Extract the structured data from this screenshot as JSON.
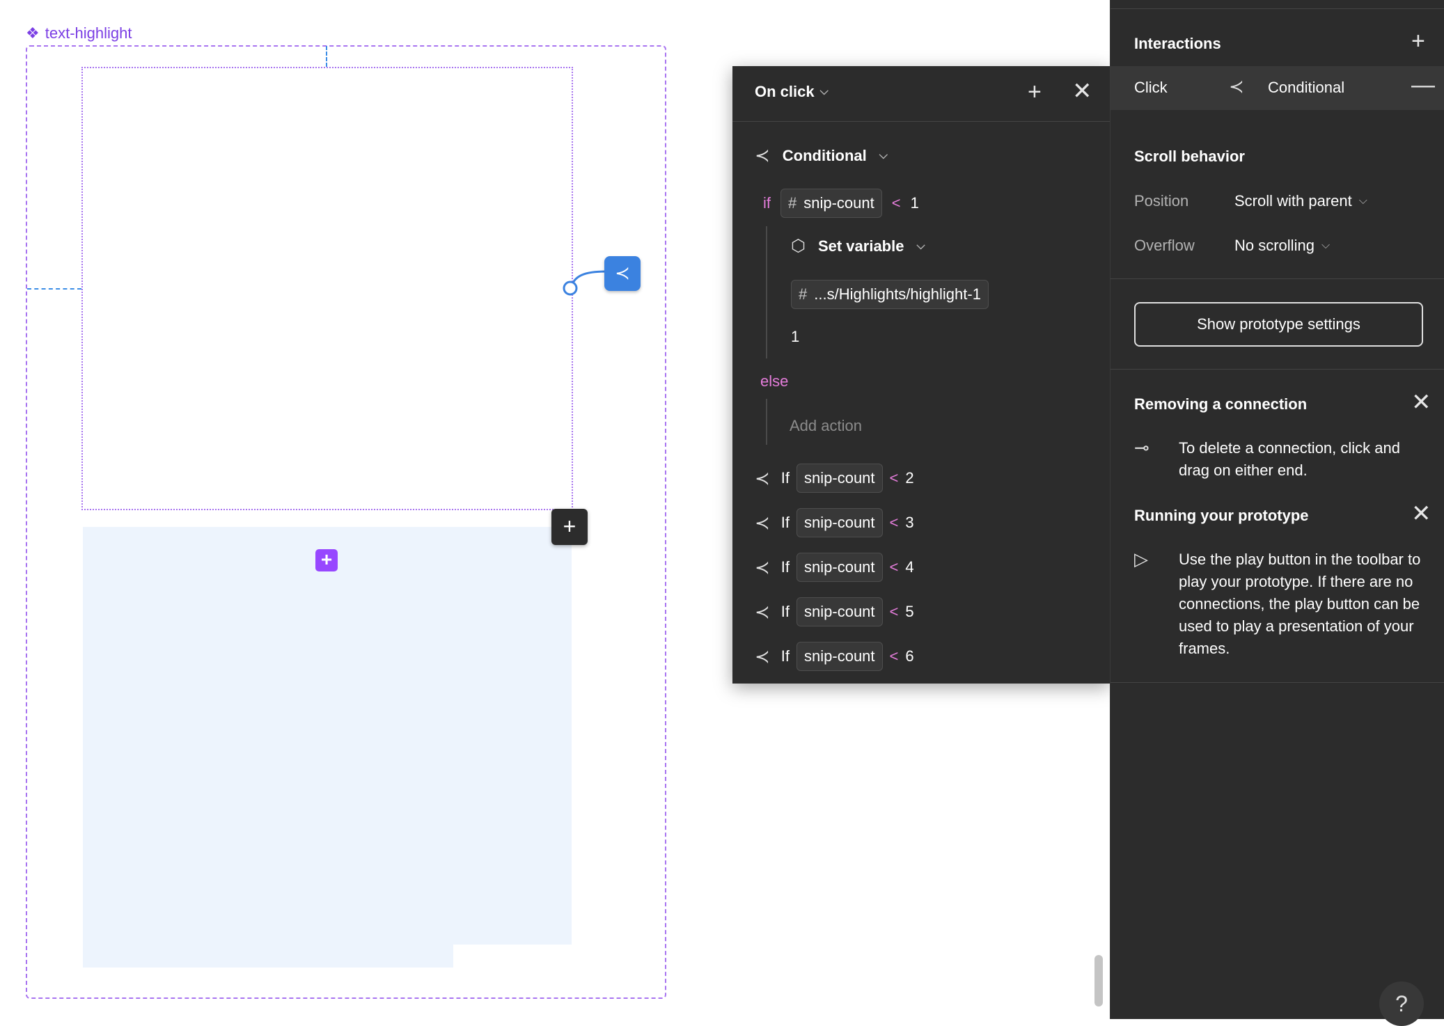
{
  "component": {
    "label": "text-highlight",
    "icon": "component-diamond-icon"
  },
  "popup": {
    "title": "On click",
    "conditional_label": "Conditional",
    "if_keyword": "if",
    "if_variable": "snip-count",
    "if_operator": "<",
    "if_value": "1",
    "set_variable_label": "Set variable",
    "set_variable_target": "...s/Highlights/highlight-1",
    "set_variable_value": "1",
    "else_keyword": "else",
    "add_action_placeholder": "Add action",
    "conditions": [
      {
        "keyword": "If",
        "variable": "snip-count",
        "operator": "<",
        "value": "2"
      },
      {
        "keyword": "If",
        "variable": "snip-count",
        "operator": "<",
        "value": "3"
      },
      {
        "keyword": "If",
        "variable": "snip-count",
        "operator": "<",
        "value": "4"
      },
      {
        "keyword": "If",
        "variable": "snip-count",
        "operator": "<",
        "value": "5"
      },
      {
        "keyword": "If",
        "variable": "snip-count",
        "operator": "<",
        "value": "6"
      }
    ]
  },
  "sidebar": {
    "interactions_title": "Interactions",
    "interaction": {
      "trigger": "Click",
      "action": "Conditional"
    },
    "scroll_title": "Scroll behavior",
    "position_label": "Position",
    "position_value": "Scroll with parent",
    "overflow_label": "Overflow",
    "overflow_value": "No scrolling",
    "prototype_button": "Show prototype settings",
    "removing_title": "Removing a connection",
    "removing_text": "To delete a connection, click and drag on either end.",
    "running_title": "Running your prototype",
    "running_text": "Use the play button in the toolbar to play your prototype. If there are no connections, the play button can be used to play a presentation of your frames.",
    "help": "?"
  },
  "colors": {
    "accent_purple": "#9747ff",
    "connector_blue": "#3b82e0",
    "keyword_pink": "#e57ddb",
    "panel_bg": "#2c2c2c"
  }
}
